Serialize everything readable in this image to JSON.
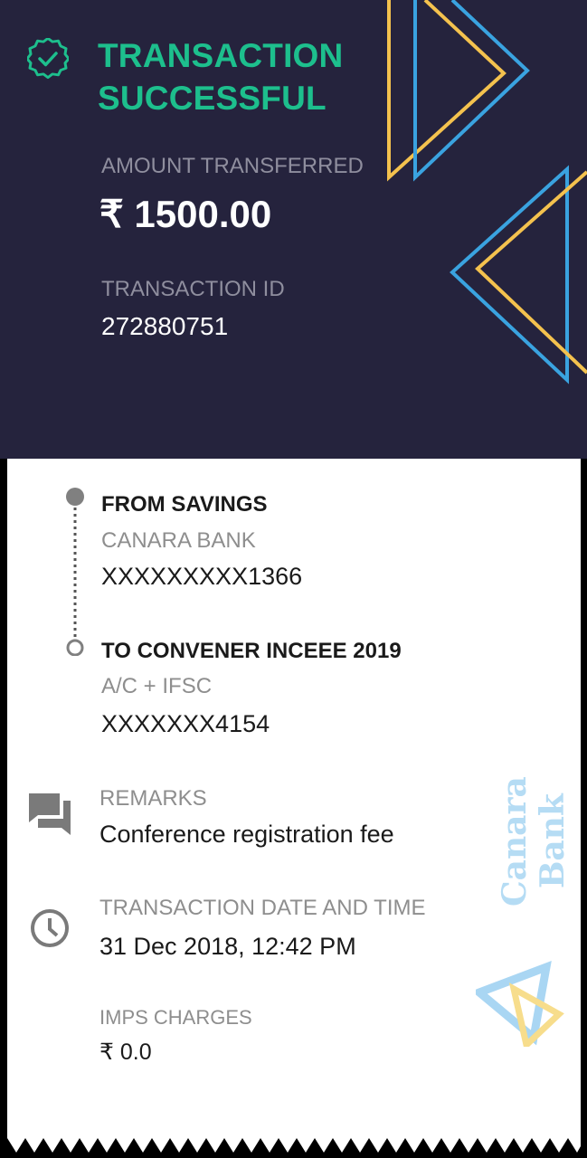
{
  "status": {
    "title": "TRANSACTION SUCCESSFUL"
  },
  "amount": {
    "label": "AMOUNT TRANSFERRED",
    "value": "₹ 1500.00"
  },
  "transaction_id": {
    "label": "TRANSACTION ID",
    "value": "272880751"
  },
  "from": {
    "title": "FROM SAVINGS",
    "bank": "CANARA BANK",
    "account": "XXXXXXXXX1366"
  },
  "to": {
    "title": "TO CONVENER INCEEE 2019",
    "type": "A/C + IFSC",
    "account": "XXXXXXX4154"
  },
  "remarks": {
    "label": "REMARKS",
    "value": "Conference registration fee"
  },
  "datetime": {
    "label": "TRANSACTION DATE AND TIME",
    "value": "31 Dec 2018, 12:42 PM"
  },
  "imps": {
    "label": "IMPS CHARGES",
    "value": "₹ 0.0"
  },
  "watermark": {
    "text": "Canara Bank"
  },
  "icons": {
    "success": "check-circle-icon",
    "remarks": "chat-bubbles-icon",
    "datetime": "clock-icon"
  },
  "colors": {
    "header_bg": "#25233d",
    "success_green": "#1dbf8d",
    "accent_blue": "#3aa3e0",
    "accent_yellow": "#f4c24e"
  }
}
